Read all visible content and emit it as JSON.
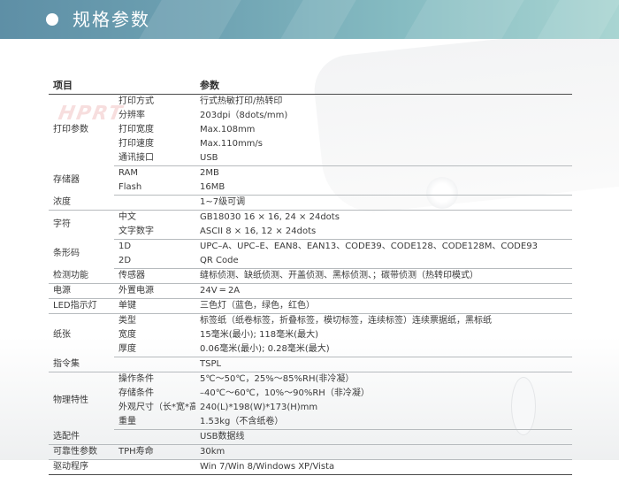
{
  "header": {
    "title": "规格参数"
  },
  "watermark": "HPRT",
  "table": {
    "col_item": "项目",
    "col_param": "参数",
    "groups": [
      {
        "category": "打印参数",
        "rows": [
          {
            "sub": "打印方式",
            "value": "行式热敏打印/热转印"
          },
          {
            "sub": "分辨率",
            "value": "203dpi（8dots/mm)"
          },
          {
            "sub": "打印宽度",
            "value": "Max.108mm"
          },
          {
            "sub": "打印速度",
            "value": "Max.110mm/s"
          },
          {
            "sub": "通讯接口",
            "value": "USB"
          }
        ]
      },
      {
        "category": "存储器",
        "rows": [
          {
            "sub": "RAM",
            "value": "2MB"
          },
          {
            "sub": "Flash",
            "value": "16MB"
          }
        ]
      },
      {
        "category": "浓度",
        "rows": [
          {
            "sub": "",
            "value": "1~7级可调"
          }
        ]
      },
      {
        "category": "字符",
        "rows": [
          {
            "sub": "中文",
            "value": "GB18030 16 × 16, 24 × 24dots"
          },
          {
            "sub": "文字数字",
            "value": "ASCII 8 × 16, 12 × 24dots"
          }
        ]
      },
      {
        "category": "条形码",
        "rows": [
          {
            "sub": "1D",
            "value": "UPC–A、UPC–E、EAN8、EAN13、CODE39、CODE128、CODE128M、CODE93"
          },
          {
            "sub": "2D",
            "value": "QR Code"
          }
        ]
      },
      {
        "category": "检测功能",
        "rows": [
          {
            "sub": "传感器",
            "value": "缝标侦测、缺纸侦测、开盖侦测、黑标侦测、；碳带侦测（热转印模式）"
          }
        ]
      },
      {
        "category": "电源",
        "rows": [
          {
            "sub": "外置电源",
            "value": "24V ═ 2A"
          }
        ]
      },
      {
        "category": "LED指示灯",
        "rows": [
          {
            "sub": "单键",
            "value": "三色灯（蓝色，绿色，红色）"
          }
        ]
      },
      {
        "category": "纸张",
        "rows": [
          {
            "sub": "类型",
            "value": "标签纸（纸卷标签，折叠标签，模切标签，连续标签）连续票据纸，黑标纸"
          },
          {
            "sub": "宽度",
            "value": "15毫米(最小); 118毫米(最大)"
          },
          {
            "sub": "厚度",
            "value": "0.06毫米(最小); 0.28毫米(最大)"
          }
        ]
      },
      {
        "category": "指令集",
        "rows": [
          {
            "sub": "",
            "value": "TSPL"
          }
        ]
      },
      {
        "category": "物理特性",
        "rows": [
          {
            "sub": "操作条件",
            "value": "5℃～50℃，25%～85%RH(非冷凝）"
          },
          {
            "sub": "存储条件",
            "value": "–40℃～60℃，10%～90%RH（非冷凝）"
          },
          {
            "sub": "外观尺寸（长*宽*高）",
            "value": "240(L)*198(W)*173(H)mm"
          },
          {
            "sub": "重量",
            "value": "1.53kg（不含纸卷）"
          }
        ]
      },
      {
        "category": "选配件",
        "rows": [
          {
            "sub": "",
            "value": "USB数据线"
          }
        ]
      },
      {
        "category": "可靠性参数",
        "rows": [
          {
            "sub": "TPH寿命",
            "value": "30km"
          }
        ]
      },
      {
        "category": "驱动程序",
        "rows": [
          {
            "sub": "",
            "value": "Win 7/Win 8/Windows XP/Vista"
          }
        ]
      }
    ]
  }
}
